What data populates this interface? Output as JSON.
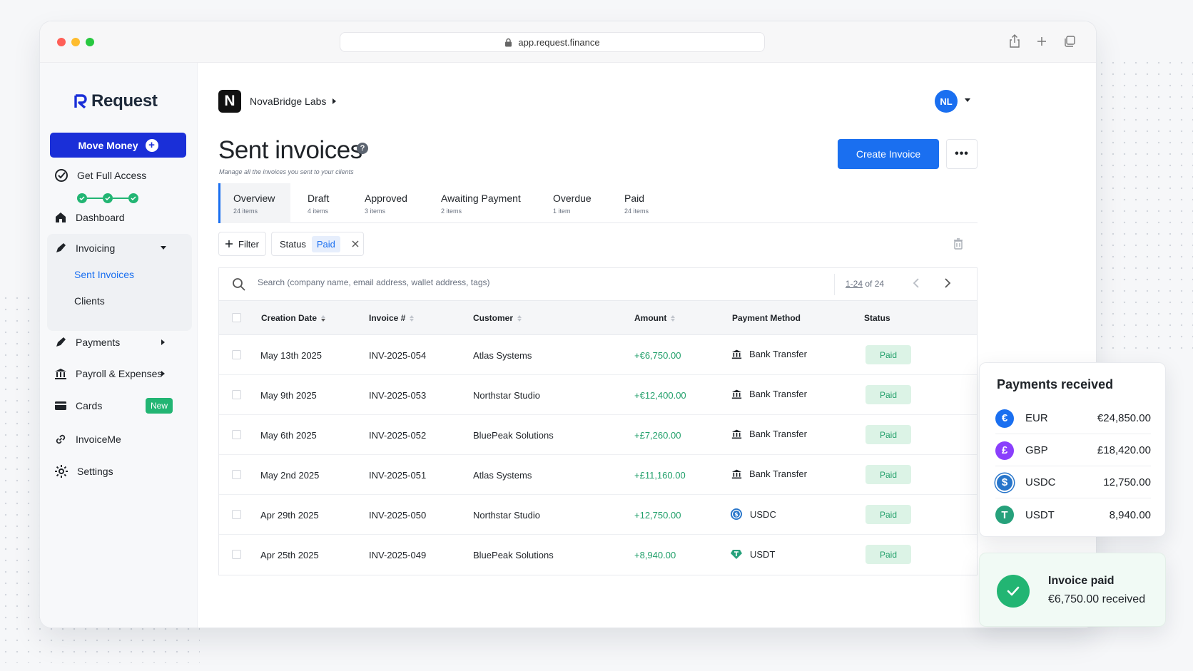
{
  "browser": {
    "url": "app.request.finance"
  },
  "brand": {
    "name": "Request",
    "accent": "#1a2fd8"
  },
  "sidebar": {
    "move_money_label": "Move Money",
    "get_full_access_label": "Get Full Access",
    "items": [
      {
        "label": "Dashboard",
        "icon": "home-icon"
      },
      {
        "label": "Invoicing",
        "icon": "invoice-icon",
        "expanded": true
      },
      {
        "label": "Payments",
        "icon": "payments-icon"
      },
      {
        "label": "Payroll & Expenses",
        "icon": "bank-icon"
      },
      {
        "label": "Cards",
        "icon": "card-icon",
        "badge": "New"
      },
      {
        "label": "InvoiceMe",
        "icon": "link-icon"
      },
      {
        "label": "Settings",
        "icon": "gear-icon"
      }
    ],
    "invoicing_sub": [
      {
        "label": "Sent Invoices",
        "active": true
      },
      {
        "label": "Clients"
      }
    ]
  },
  "header": {
    "org_initial": "N",
    "org_name": "NovaBridge Labs",
    "avatar_initials": "NL"
  },
  "page": {
    "title": "Sent invoices",
    "subtitle": "Manage all the invoices you sent to your clients",
    "create_label": "Create Invoice",
    "more_label": "•••"
  },
  "tabs": [
    {
      "label": "Overview",
      "count": "24 items",
      "active": true
    },
    {
      "label": "Draft",
      "count": "4 items"
    },
    {
      "label": "Approved",
      "count": "3 items"
    },
    {
      "label": "Awaiting Payment",
      "count": "2 items"
    },
    {
      "label": "Overdue",
      "count": "1 item"
    },
    {
      "label": "Paid",
      "count": "24 items"
    }
  ],
  "filters": {
    "filter_label": "Filter",
    "status_label": "Status",
    "status_value": "Paid"
  },
  "search": {
    "placeholder": "Search (company name, email address, wallet address, tags)",
    "range": "1-24",
    "of_text": " of 24"
  },
  "table": {
    "headers": [
      "Creation Date",
      "Invoice #",
      "Customer",
      "Amount",
      "Payment Method",
      "Status"
    ],
    "rows": [
      {
        "date": "May 13th 2025",
        "invoice": "INV-2025-054",
        "customer": "Atlas Systems",
        "amount": "+€6,750.00",
        "method": "Bank Transfer",
        "method_icon": "bank-icon",
        "status": "Paid"
      },
      {
        "date": "May 9th 2025",
        "invoice": "INV-2025-053",
        "customer": "Northstar Studio",
        "amount": "+€12,400.00",
        "method": "Bank Transfer",
        "method_icon": "bank-icon",
        "status": "Paid"
      },
      {
        "date": "May 6th 2025",
        "invoice": "INV-2025-052",
        "customer": "BluePeak Solutions",
        "amount": "+£7,260.00",
        "method": "Bank Transfer",
        "method_icon": "bank-icon",
        "status": "Paid"
      },
      {
        "date": "May 2nd 2025",
        "invoice": "INV-2025-051",
        "customer": "Atlas Systems",
        "amount": "+£11,160.00",
        "method": "Bank Transfer",
        "method_icon": "bank-icon",
        "status": "Paid"
      },
      {
        "date": "Apr 29th 2025",
        "invoice": "INV-2025-050",
        "customer": "Northstar Studio",
        "amount": "+12,750.00",
        "method": "USDC",
        "method_icon": "usdc-icon",
        "status": "Paid"
      },
      {
        "date": "Apr 25th 2025",
        "invoice": "INV-2025-049",
        "customer": "BluePeak Solutions",
        "amount": "+8,940.00",
        "method": "USDT",
        "method_icon": "usdt-icon",
        "status": "Paid"
      }
    ]
  },
  "payments_received": {
    "title": "Payments received",
    "items": [
      {
        "code": "EUR",
        "value": "€24,850.00",
        "symbol": "€",
        "color": "#1a6ff0"
      },
      {
        "code": "GBP",
        "value": "£18,420.00",
        "symbol": "£",
        "color": "#8a3ffc"
      },
      {
        "code": "USDC",
        "value": "12,750.00",
        "symbol": "$",
        "color": "#2775ca"
      },
      {
        "code": "USDT",
        "value": "8,940.00",
        "symbol": "T",
        "color": "#26a17b"
      }
    ]
  },
  "toast": {
    "title": "Invoice paid",
    "subtitle": "€6,750.00 received"
  }
}
